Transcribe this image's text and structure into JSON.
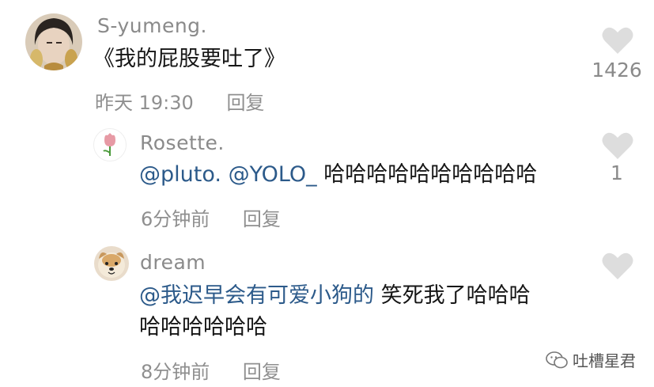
{
  "comments": [
    {
      "username": "S-yumeng.",
      "text": "《我的屁股要吐了》",
      "time": "昨天 19:30",
      "reply_label": "回复",
      "likes": "1426"
    },
    {
      "username": "Rosette.",
      "mentions": [
        "@pluto.",
        "@YOLO_"
      ],
      "text": " 哈哈哈哈哈哈哈哈哈哈",
      "time": "6分钟前",
      "reply_label": "回复",
      "likes": "1"
    },
    {
      "username": "dream",
      "mention": "@我迟早会有可爱小狗的",
      "text_line1": " 笑死我了哈哈哈",
      "text_line2": "哈哈哈哈哈哈",
      "time": "8分钟前",
      "reply_label": "回复"
    }
  ],
  "watermark": {
    "text": "吐槽星君",
    "icon": "wechat-icon"
  },
  "colors": {
    "mention": "#2c5a8a",
    "meta": "#8f8f8f",
    "heart": "#dddddd"
  }
}
